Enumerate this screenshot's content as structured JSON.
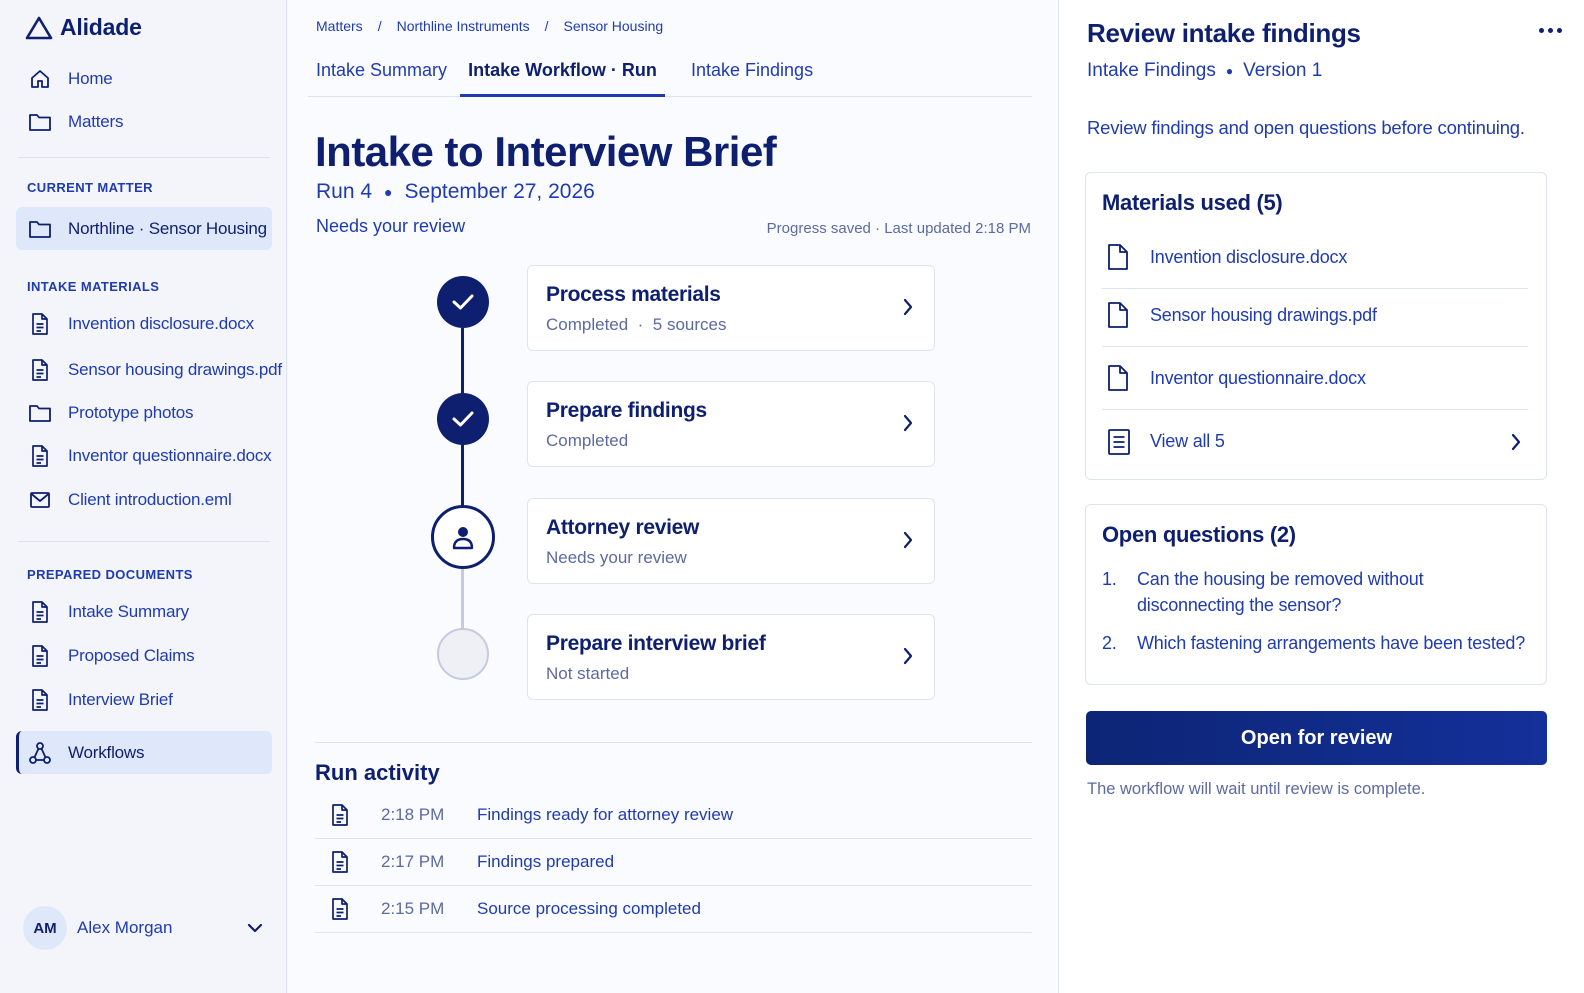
{
  "app": {
    "name": "Alidade"
  },
  "sidebar": {
    "nav": [
      {
        "label": "Home",
        "icon": "home-icon"
      },
      {
        "label": "Matters",
        "icon": "folder-icon"
      }
    ],
    "current_matter": {
      "heading": "CURRENT MATTER",
      "item": "Northline · Sensor Housing"
    },
    "intake_materials": {
      "heading": "INTAKE MATERIALS",
      "items": [
        {
          "label": "Invention disclosure.docx",
          "icon": "document-icon"
        },
        {
          "label": "Sensor housing drawings.pdf",
          "icon": "document-icon"
        },
        {
          "label": "Prototype photos",
          "icon": "folder-icon"
        },
        {
          "label": "Inventor questionnaire.docx",
          "icon": "document-icon"
        },
        {
          "label": "Client introduction.eml",
          "icon": "mail-icon"
        }
      ]
    },
    "prepared_documents": {
      "heading": "PREPARED DOCUMENTS",
      "items": [
        {
          "label": "Intake Summary",
          "icon": "document-icon"
        },
        {
          "label": "Proposed Claims",
          "icon": "document-icon"
        },
        {
          "label": "Interview Brief",
          "icon": "document-icon"
        }
      ]
    },
    "workflows": {
      "label": "Workflows",
      "icon": "workflow-icon"
    },
    "user": {
      "initials": "AM",
      "name": "Alex Morgan"
    }
  },
  "main": {
    "breadcrumb": [
      "Matters",
      "Northline Instruments",
      "Sensor Housing"
    ],
    "breadcrumb_sep": "/",
    "tabs": [
      {
        "label": "Intake Summary",
        "active": false
      },
      {
        "label": "Intake Workflow · Run",
        "active": true
      },
      {
        "label": "Intake Findings",
        "active": false
      }
    ],
    "title": "Intake to Interview Brief",
    "run_label": "Run 4",
    "run_date": "September 27, 2026",
    "status": "Needs your review",
    "saved": "Progress saved · Last updated 2:18 PM",
    "steps": [
      {
        "title": "Process materials",
        "subtitle": "Completed  ·  5 sources",
        "state": "completed"
      },
      {
        "title": "Prepare findings",
        "subtitle": "Completed",
        "state": "completed"
      },
      {
        "title": "Attorney review",
        "subtitle": "Needs your review",
        "state": "review"
      },
      {
        "title": "Prepare interview brief",
        "subtitle": "Not started",
        "state": "not-started"
      }
    ],
    "activity": {
      "title": "Run activity",
      "rows": [
        {
          "time": "2:18 PM",
          "text": "Findings ready for attorney review"
        },
        {
          "time": "2:17 PM",
          "text": "Findings prepared"
        },
        {
          "time": "2:15 PM",
          "text": "Source processing completed"
        }
      ]
    }
  },
  "panel": {
    "title": "Review intake findings",
    "subtitle_doc": "Intake Findings",
    "subtitle_version": "Version 1",
    "description": "Review findings and open questions before continuing.",
    "materials": {
      "title": "Materials used (5)",
      "items": [
        "Invention disclosure.docx",
        "Sensor housing drawings.pdf",
        "Inventor questionnaire.docx"
      ],
      "view_all": "View all 5"
    },
    "questions": {
      "title": "Open questions (2)",
      "items": [
        {
          "num": "1.",
          "text": "Can the housing be removed without disconnecting the sensor?"
        },
        {
          "num": "2.",
          "text": "Which fastening arrangements have been tested?"
        }
      ]
    },
    "primary_button": "Open for review",
    "note": "The workflow will wait until review is complete."
  },
  "colors": {
    "navy": "#0d1f6e",
    "link_blue": "#1f3bb0",
    "muted": "#5c6aa0",
    "active_bg": "#dfe8fb"
  }
}
